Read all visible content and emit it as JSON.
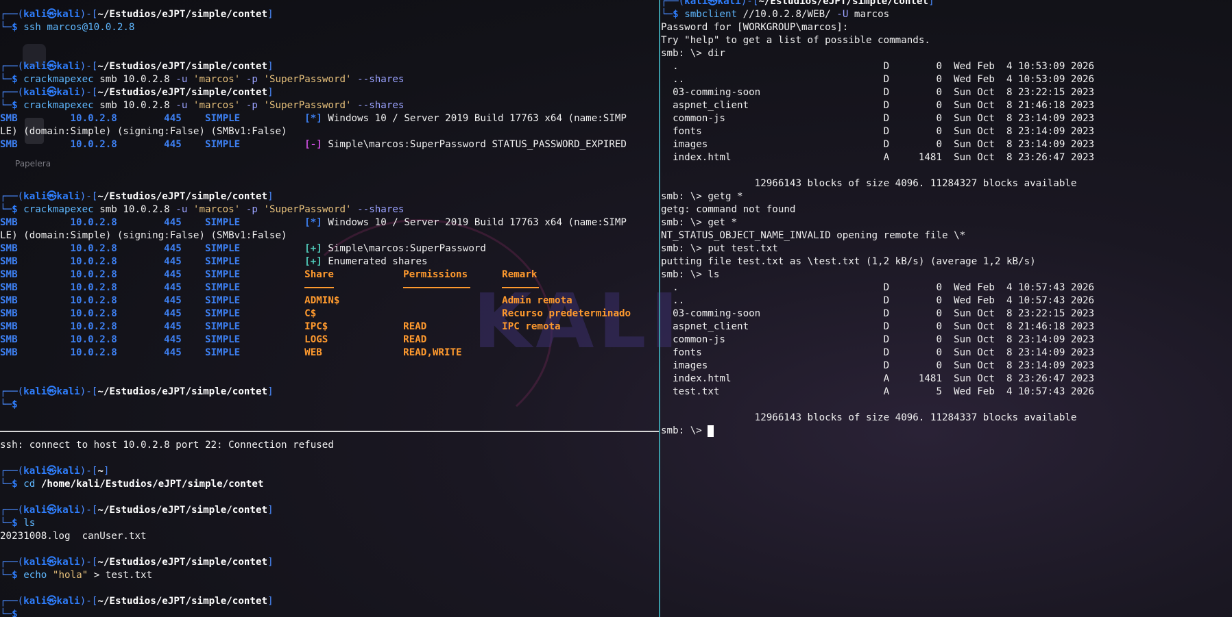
{
  "desktop": {
    "trash_label": "Papelera",
    "watermark": "KALI"
  },
  "prompt": {
    "user": "kali",
    "at": "㉿",
    "host": "kali",
    "cwd_contet": "~/Estudios/eJPT/simple/contet",
    "cwd_home": "~",
    "cwd_web": "~/Estudios/eJPT/simple/contet"
  },
  "top_left": {
    "cmd_ssh": "ssh marcos@10.0.2.8",
    "cme_tool": "crackmapexec",
    "cme_args1": " smb 10.0.2.8 ",
    "cme_u": "-u",
    "cme_user": "'marcos'",
    "cme_p": "-p",
    "cme_pass": "'SuperPassword'",
    "cme_shares": "--shares",
    "row_prefix": "SMB         10.0.2.8        445    SIMPLE           ",
    "windows_info": "Windows 10 / Server 2019 Build 17763 x64 (name:SIMP",
    "windows_info_cont": "LE) (domain:Simple) (signing:False) (SMBv1:False)",
    "expired": "Simple\\marcos:SuperPassword STATUS_PASSWORD_EXPIRED",
    "success": "Simple\\marcos:SuperPassword",
    "enumerated": "Enumerated shares",
    "headers": {
      "share": "Share",
      "permissions": "Permissions",
      "remark": "Remark"
    },
    "shares": [
      {
        "share": "ADMIN$",
        "permissions": "",
        "remark": "Admin remota"
      },
      {
        "share": "C$",
        "permissions": "",
        "remark": "Recurso predeterminado"
      },
      {
        "share": "IPC$",
        "permissions": "READ",
        "remark": "IPC remota"
      },
      {
        "share": "LOGS",
        "permissions": "READ",
        "remark": ""
      },
      {
        "share": "WEB",
        "permissions": "READ,WRITE",
        "remark": ""
      }
    ],
    "tag_star": "[*]",
    "tag_minus": "[-]",
    "tag_plus": "[+]"
  },
  "bottom_left": {
    "ssh_error": "ssh: connect to host 10.0.2.8 port 22: Connection refused",
    "cmd_cd": "cd",
    "cd_path": "/home/kali/Estudios/eJPT/simple/contet",
    "cmd_ls": "ls",
    "ls_output": "20231008.log  canUser.txt",
    "cmd_echo": "echo",
    "echo_str": "\"hola\"",
    "echo_rest": " > test.txt"
  },
  "right": {
    "cmd_smbclient": "smbclient",
    "smbclient_args": " //10.0.2.8/WEB/ ",
    "smbclient_u": "-U",
    "smbclient_user": " marcos",
    "password_prompt": "Password for [WORKGROUP\\marcos]:",
    "help_hint": "Try \"help\" to get a list of possible commands.",
    "smb_prompt": "smb: \\> ",
    "cmd_dir": "dir",
    "dir1": [
      "  .                                   D        0  Wed Feb  4 10:53:09 2026",
      "  ..                                  D        0  Wed Feb  4 10:53:09 2026",
      "  03-comming-soon                     D        0  Sun Oct  8 23:22:15 2023",
      "  aspnet_client                       D        0  Sun Oct  8 21:46:18 2023",
      "  common-js                           D        0  Sun Oct  8 23:14:09 2023",
      "  fonts                               D        0  Sun Oct  8 23:14:09 2023",
      "  images                              D        0  Sun Oct  8 23:14:09 2023",
      "  index.html                          A     1481  Sun Oct  8 23:26:47 2023"
    ],
    "blocks1": "                12966143 blocks of size 4096. 11284327 blocks available",
    "cmd_getg": "getg *",
    "getg_err": "getg: command not found",
    "cmd_get": "get *",
    "get_err": "NT_STATUS_OBJECT_NAME_INVALID opening remote file \\*",
    "cmd_put": "put test.txt",
    "put_out": "putting file test.txt as \\test.txt (1,2 kB/s) (average 1,2 kB/s)",
    "cmd_ls": "ls",
    "dir2": [
      "  .                                   D        0  Wed Feb  4 10:57:43 2026",
      "  ..                                  D        0  Wed Feb  4 10:57:43 2026",
      "  03-comming-soon                     D        0  Sun Oct  8 23:22:15 2023",
      "  aspnet_client                       D        0  Sun Oct  8 21:46:18 2023",
      "  common-js                           D        0  Sun Oct  8 23:14:09 2023",
      "  fonts                               D        0  Sun Oct  8 23:14:09 2023",
      "  images                              D        0  Sun Oct  8 23:14:09 2023",
      "  index.html                          A     1481  Sun Oct  8 23:26:47 2023",
      "  test.txt                            A        5  Wed Feb  4 10:57:43 2026"
    ],
    "blocks2": "                12966143 blocks of size 4096. 11284337 blocks available"
  }
}
